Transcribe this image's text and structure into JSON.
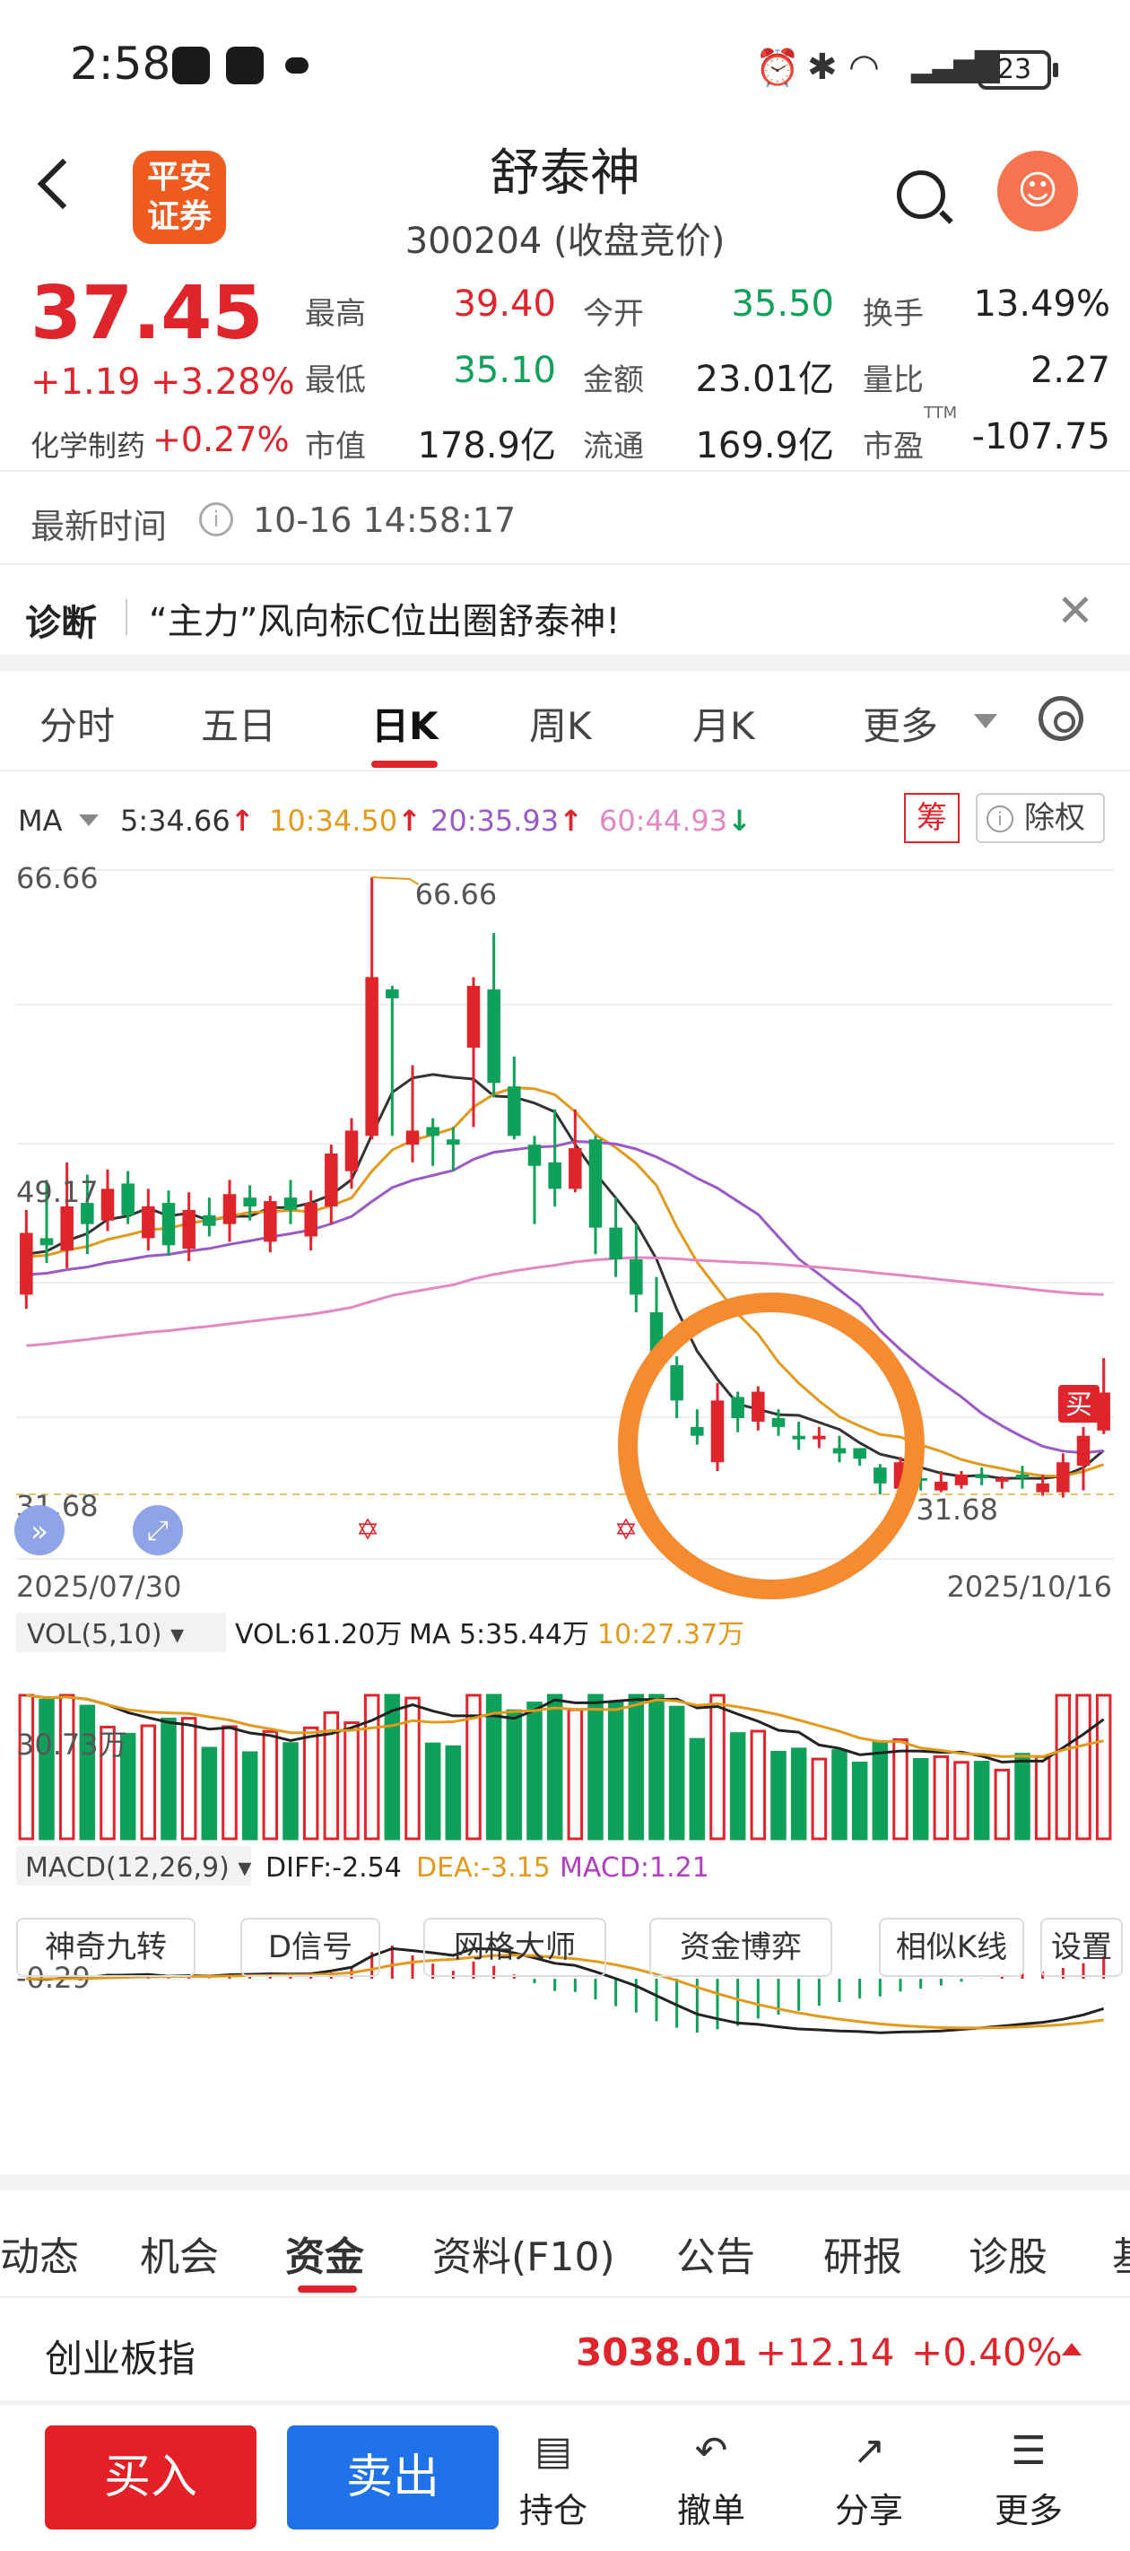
{
  "status_bar": {
    "time": "2:58",
    "battery": "23"
  },
  "header": {
    "logo_text": "平安\n证券",
    "title": "舒泰神",
    "subtitle": "300204 (收盘竞价)"
  },
  "quote": {
    "price": "37.45",
    "change": "+1.19",
    "change_pct": "+3.28%",
    "sector": "化学制药",
    "sector_pct": "+0.27%",
    "fields": [
      {
        "label": "最高",
        "value": "39.40",
        "color": "#e0242b"
      },
      {
        "label": "今开",
        "value": "35.50",
        "color": "#0fa05a"
      },
      {
        "label": "换手",
        "value": "13.49%",
        "color": "#222"
      },
      {
        "label": "最低",
        "value": "35.10",
        "color": "#0fa05a"
      },
      {
        "label": "金额",
        "value": "23.01亿",
        "color": "#222"
      },
      {
        "label": "量比",
        "value": "2.27",
        "color": "#222"
      },
      {
        "label": "市值",
        "value": "178.9亿",
        "color": "#222"
      },
      {
        "label": "流通",
        "value": "169.9亿",
        "color": "#222"
      },
      {
        "label": "市盈",
        "value": "-107.75",
        "color": "#222"
      }
    ],
    "pe_suffix": "TTM"
  },
  "update": {
    "label": "最新时间",
    "value": "10-16 14:58:17"
  },
  "diagnosis": {
    "label": "诊断",
    "text": "“主力”风向标C位出圈舒泰神!"
  },
  "chart_tabs": [
    "分时",
    "五日",
    "日K",
    "周K",
    "月K",
    "更多"
  ],
  "ma_row": {
    "label": "MA",
    "items": [
      {
        "text": "5:34.66",
        "arrow": "↑",
        "color": "#333",
        "arrow_color": "#e0242b"
      },
      {
        "text": "10:34.50",
        "arrow": "↑",
        "color": "#e39a1b",
        "arrow_color": "#e0242b"
      },
      {
        "text": "20:35.93",
        "arrow": "↑",
        "color": "#9b59c8",
        "arrow_color": "#e0242b"
      },
      {
        "text": "60:44.93",
        "arrow": "↓",
        "color": "#e486c2",
        "arrow_color": "#0fa05a"
      }
    ],
    "chou": "筹",
    "chuquan": "除权"
  },
  "chart_data": {
    "type": "candlestick",
    "x_start": "2025/07/30",
    "x_end": "2025/10/16",
    "ylabels": [
      "66.66",
      "49.17",
      "31.68"
    ],
    "max_label": "66.66",
    "min_label": "31.68",
    "buy_marker": "买",
    "candles": [
      [
        43.0,
        46.5,
        42.2,
        47.8
      ],
      [
        46.2,
        45.8,
        44.8,
        49.5
      ],
      [
        45.5,
        48.0,
        44.5,
        50.5
      ],
      [
        48.2,
        47.0,
        45.3,
        49.8
      ],
      [
        47.2,
        49.0,
        46.6,
        50.1
      ],
      [
        49.3,
        47.5,
        47.0,
        50.0
      ],
      [
        46.2,
        48.0,
        45.5,
        49.0
      ],
      [
        48.2,
        45.8,
        45.2,
        48.9
      ],
      [
        45.6,
        47.8,
        44.9,
        48.8
      ],
      [
        47.5,
        46.9,
        46.3,
        48.5
      ],
      [
        47.0,
        48.7,
        46.0,
        49.5
      ],
      [
        48.5,
        48.0,
        47.2,
        49.2
      ],
      [
        46.0,
        48.3,
        45.4,
        48.6
      ],
      [
        48.5,
        47.8,
        47.0,
        49.5
      ],
      [
        46.3,
        48.2,
        45.5,
        48.9
      ],
      [
        48.0,
        51.0,
        47.0,
        51.5
      ],
      [
        50.0,
        52.3,
        49.0,
        53.0
      ],
      [
        52.0,
        61.0,
        51.8,
        66.66
      ],
      [
        60.3,
        59.8,
        52.0,
        60.5
      ],
      [
        51.5,
        52.3,
        50.5,
        56.0
      ],
      [
        52.5,
        52.0,
        50.3,
        53.0
      ],
      [
        51.8,
        51.5,
        50.0,
        52.5
      ],
      [
        57.0,
        60.5,
        52.5,
        61.0
      ],
      [
        60.3,
        55.0,
        54.2,
        63.5
      ],
      [
        54.8,
        52.0,
        51.8,
        56.5
      ],
      [
        51.5,
        50.3,
        47.0,
        52.0
      ],
      [
        50.5,
        49.0,
        48.0,
        53.5
      ],
      [
        49.0,
        51.3,
        48.8,
        53.5
      ],
      [
        51.8,
        46.8,
        45.3,
        52.0
      ],
      [
        46.8,
        45.0,
        44.0,
        48.5
      ],
      [
        45.0,
        43.0,
        42.0,
        47.0
      ],
      [
        42.0,
        39.0,
        38.5,
        44.0
      ],
      [
        39.0,
        37.0,
        36.0,
        39.5
      ],
      [
        35.5,
        35.0,
        34.5,
        36.5
      ],
      [
        33.5,
        37.0,
        33.0,
        38.0
      ],
      [
        37.2,
        36.0,
        35.2,
        37.5
      ],
      [
        35.8,
        37.5,
        35.3,
        37.8
      ],
      [
        36.0,
        35.5,
        35.0,
        36.5
      ],
      [
        35.0,
        34.8,
        34.2,
        35.8
      ],
      [
        34.8,
        35.0,
        34.3,
        35.5
      ],
      [
        34.3,
        34.0,
        33.5,
        35.0
      ],
      [
        34.3,
        33.7,
        33.3,
        34.3
      ],
      [
        33.2,
        32.3,
        31.68,
        33.4
      ],
      [
        32.0,
        33.5,
        31.9,
        33.8
      ],
      [
        32.6,
        32.5,
        31.9,
        33.0
      ],
      [
        31.9,
        32.4,
        31.8,
        33.0
      ],
      [
        32.2,
        32.8,
        32.0,
        33.0
      ],
      [
        32.8,
        32.6,
        32.2,
        33.2
      ],
      [
        32.4,
        32.6,
        32.0,
        32.7
      ],
      [
        32.8,
        32.6,
        32.0,
        33.3
      ],
      [
        31.8,
        32.3,
        31.6,
        32.8
      ],
      [
        31.8,
        33.5,
        31.5,
        34.0
      ],
      [
        33.3,
        35.0,
        31.9,
        35.5
      ],
      [
        35.3,
        37.45,
        35.1,
        39.4
      ]
    ],
    "ma_series": [
      {
        "name": "5",
        "color": "#333"
      },
      {
        "name": "10",
        "color": "#e39a1b"
      },
      {
        "name": "20",
        "color": "#9b59c8"
      },
      {
        "name": "60",
        "color": "#e486c2"
      }
    ],
    "vol": {
      "label": "VOL(5,10)",
      "vol_text": "VOL:61.20万",
      "ma5_text": "MA 5:35.44万",
      "ma10_text": "10:27.37万",
      "axis_label": "30.73万"
    },
    "macd": {
      "label": "MACD(12,26,9)",
      "diff_text": "DIFF:-2.54",
      "dea_text": "DEA:-3.15",
      "macd_text": "MACD:1.21",
      "axis_label": "-0.29"
    }
  },
  "tools": [
    "神奇九转",
    "D信号",
    "网格大师",
    "资金博弈",
    "相似K线",
    "设置"
  ],
  "subtabs": [
    "动态",
    "机会",
    "资金",
    "资料(F10)",
    "公告",
    "研报",
    "诊股",
    "基"
  ],
  "index": {
    "name": "创业板指",
    "value": "3038.01",
    "change": "+12.14",
    "pct": "+0.40%"
  },
  "bottom": {
    "buy": "买入",
    "sell": "卖出",
    "nav": [
      {
        "label": "持仓",
        "icon": "list-icon",
        "glyph": "▤"
      },
      {
        "label": "撤单",
        "icon": "undo-icon",
        "glyph": "↶"
      },
      {
        "label": "分享",
        "icon": "share-icon",
        "glyph": "↗"
      },
      {
        "label": "更多",
        "icon": "menu-icon",
        "glyph": "☰"
      }
    ]
  }
}
